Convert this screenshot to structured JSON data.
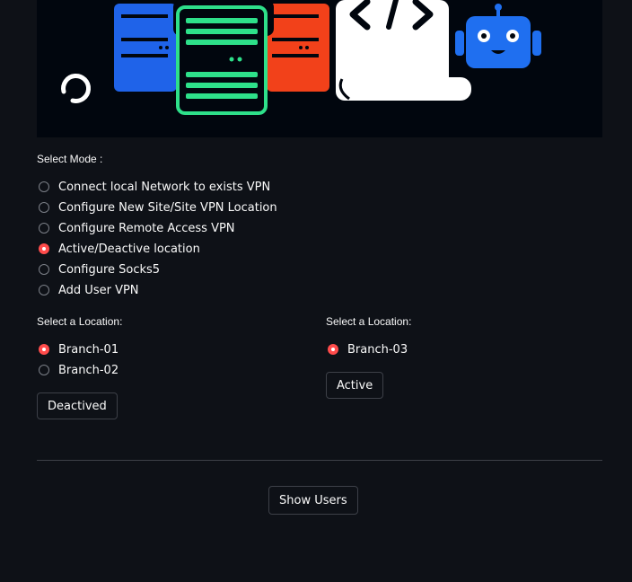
{
  "mode": {
    "label": "Select Mode :",
    "options": [
      {
        "label": "Connect local Network to exists VPN",
        "selected": false
      },
      {
        "label": "Configure New Site/Site VPN Location",
        "selected": false
      },
      {
        "label": "Configure Remote Access VPN",
        "selected": false
      },
      {
        "label": "Active/Deactive location",
        "selected": true
      },
      {
        "label": "Configure Socks5",
        "selected": false
      },
      {
        "label": "Add User VPN",
        "selected": false
      }
    ]
  },
  "left_panel": {
    "label": "Select a Location:",
    "options": [
      {
        "label": "Branch-01",
        "selected": true
      },
      {
        "label": "Branch-02",
        "selected": false
      }
    ],
    "button": "Deactived"
  },
  "right_panel": {
    "label": "Select a Location:",
    "options": [
      {
        "label": "Branch-03",
        "selected": true
      }
    ],
    "button": "Active"
  },
  "show_users_button": "Show Users",
  "colors": {
    "background": "#0e1117",
    "accent": "#ff4b4b",
    "server_blue": "#1f63e9",
    "server_green": "#2ee08a",
    "server_red": "#f2411a",
    "robot_blue": "#1f6ff0"
  }
}
